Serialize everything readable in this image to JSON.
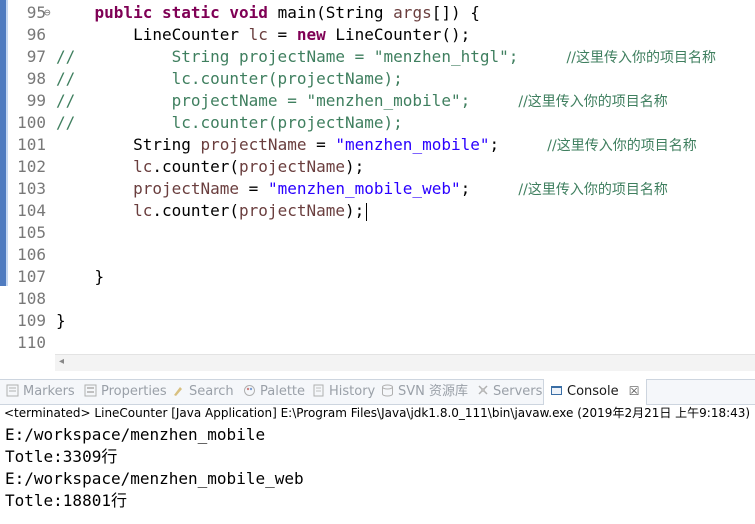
{
  "editor": {
    "lines": [
      {
        "num": "95",
        "fold": "⊖",
        "parts": [
          {
            "t": "    "
          },
          {
            "t": "public",
            "c": "kw"
          },
          {
            "t": " "
          },
          {
            "t": "static",
            "c": "kw"
          },
          {
            "t": " "
          },
          {
            "t": "void",
            "c": "kw"
          },
          {
            "t": " main(String "
          },
          {
            "t": "args",
            "c": "var"
          },
          {
            "t": "[]) {"
          }
        ]
      },
      {
        "num": "96",
        "parts": [
          {
            "t": "        LineCounter "
          },
          {
            "t": "lc",
            "c": "var"
          },
          {
            "t": " = "
          },
          {
            "t": "new",
            "c": "kw"
          },
          {
            "t": " LineCounter();"
          }
        ]
      },
      {
        "num": "97",
        "comment_prefix": "//",
        "parts": [
          {
            "t": "          String projectName = \"menzhen_htgl\";     ",
            "c": "com"
          },
          {
            "t": "//这里传入你的项目名称",
            "c": "com cjk"
          }
        ]
      },
      {
        "num": "98",
        "comment_prefix": "//",
        "parts": [
          {
            "t": "          lc.counter(projectName);",
            "c": "com"
          }
        ]
      },
      {
        "num": "99",
        "comment_prefix": "//",
        "parts": [
          {
            "t": "          projectName = \"menzhen_mobile\";     ",
            "c": "com"
          },
          {
            "t": "//这里传入你的项目名称",
            "c": "com cjk"
          }
        ]
      },
      {
        "num": "100",
        "comment_prefix": "//",
        "parts": [
          {
            "t": "          lc.counter(projectName);",
            "c": "com"
          }
        ]
      },
      {
        "num": "101",
        "parts": [
          {
            "t": "        String "
          },
          {
            "t": "projectName",
            "c": "var"
          },
          {
            "t": " = "
          },
          {
            "t": "\"menzhen_mobile\"",
            "c": "str"
          },
          {
            "t": ";     "
          },
          {
            "t": "//这里传入你的项目名称",
            "c": "com cjk"
          }
        ]
      },
      {
        "num": "102",
        "parts": [
          {
            "t": "        "
          },
          {
            "t": "lc",
            "c": "var"
          },
          {
            "t": ".counter("
          },
          {
            "t": "projectName",
            "c": "var"
          },
          {
            "t": ");"
          }
        ]
      },
      {
        "num": "103",
        "parts": [
          {
            "t": "        "
          },
          {
            "t": "projectName",
            "c": "var"
          },
          {
            "t": " = "
          },
          {
            "t": "\"menzhen_mobile_web\"",
            "c": "str"
          },
          {
            "t": ";     "
          },
          {
            "t": "//这里传入你的项目名称",
            "c": "com cjk"
          }
        ]
      },
      {
        "num": "104",
        "caret": true,
        "parts": [
          {
            "t": "        "
          },
          {
            "t": "lc",
            "c": "var"
          },
          {
            "t": ".counter("
          },
          {
            "t": "projectName",
            "c": "var"
          },
          {
            "t": ");"
          }
        ]
      },
      {
        "num": "105",
        "parts": []
      },
      {
        "num": "106",
        "parts": []
      },
      {
        "num": "107",
        "parts": [
          {
            "t": "    }"
          }
        ]
      },
      {
        "num": "108",
        "parts": []
      },
      {
        "num": "109",
        "parts": [
          {
            "t": "}"
          }
        ]
      },
      {
        "num": "110",
        "parts": []
      }
    ]
  },
  "scrollbar": {
    "left_arrow": "◂"
  },
  "views": {
    "tabs": [
      {
        "label": "Markers",
        "icon": "markers-icon"
      },
      {
        "label": "Properties",
        "icon": "properties-icon"
      },
      {
        "label": "Search",
        "icon": "search-icon"
      },
      {
        "label": "Palette",
        "icon": "palette-icon"
      },
      {
        "label": "History",
        "icon": "history-icon"
      },
      {
        "label": "SVN 资源库",
        "icon": "svn-repository-icon"
      },
      {
        "label": "Servers",
        "icon": "servers-icon"
      },
      {
        "label": "Console",
        "icon": "console-icon",
        "active": true,
        "close": "☒"
      }
    ]
  },
  "console": {
    "status": "<terminated> LineCounter [Java Application] E:\\Program Files\\Java\\jdk1.8.0_111\\bin\\javaw.exe (2019年2月21日 上午9:18:43)",
    "output": [
      "E:/workspace/menzhen_mobile",
      "Totle:3309行",
      "E:/workspace/menzhen_mobile_web",
      "Totle:18801行"
    ]
  },
  "colors": {
    "keyword": "#7f0055",
    "string": "#2a00ff",
    "comment": "#3f7f5f",
    "variable": "#6a3e3e",
    "line_number": "#787878",
    "ruler": "#4f7bc0"
  }
}
